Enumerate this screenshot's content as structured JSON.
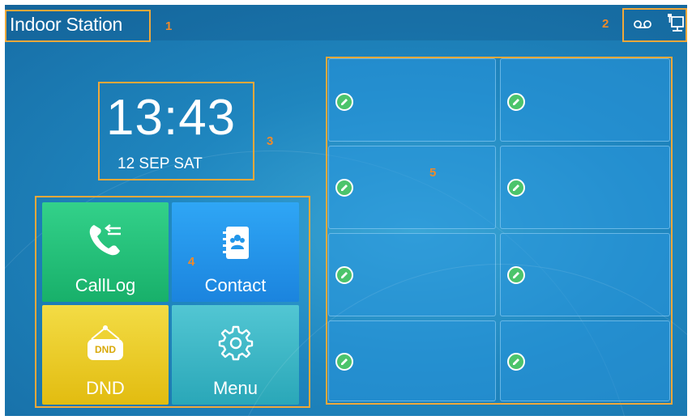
{
  "header": {
    "title": "Indoor Station",
    "icons": [
      "voicemail-icon",
      "network-icon"
    ]
  },
  "clock": {
    "time": "13:43",
    "date": "12 SEP SAT"
  },
  "tiles": [
    {
      "label": "CallLog",
      "icon": "call-log-icon",
      "color": "#1fbd74"
    },
    {
      "label": "Contact",
      "icon": "contact-book-icon",
      "color": "#2196ea"
    },
    {
      "label": "DND",
      "icon": "dnd-sign-icon",
      "sign_text": "DND",
      "color": "#eccc22"
    },
    {
      "label": "Menu",
      "icon": "gear-icon",
      "color": "#3bb8c6"
    }
  ],
  "dsskeys": {
    "count": 8,
    "icon": "edit-pencil-icon"
  },
  "annotations": [
    "1",
    "2",
    "3",
    "4",
    "5"
  ],
  "colors": {
    "annotation": "#f0a83a",
    "background": "#1f86bf"
  }
}
